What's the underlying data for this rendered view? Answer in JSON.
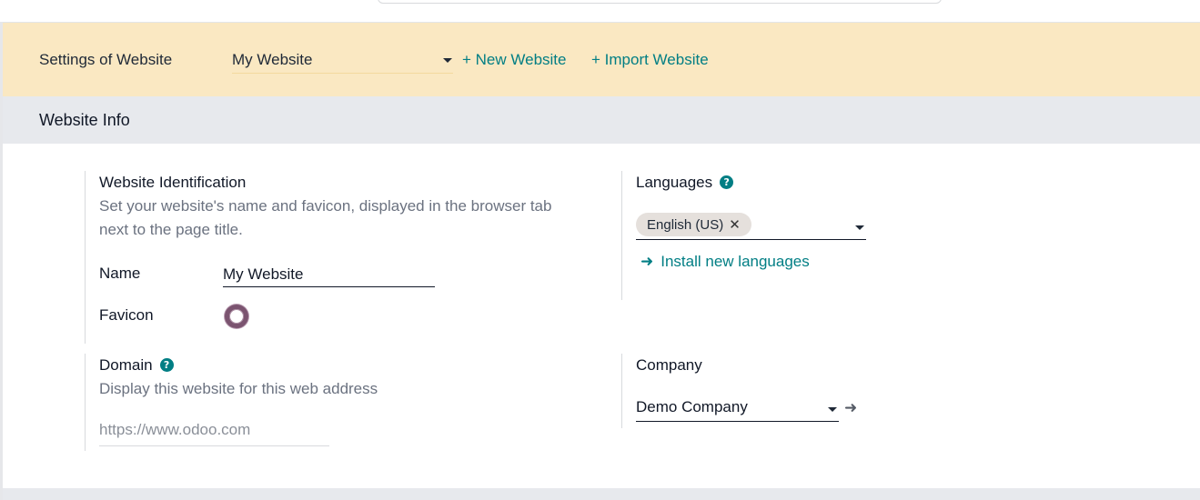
{
  "header": {
    "title": "Settings of Website",
    "selected_website": "My Website",
    "new_website_label": "+ New Website",
    "import_website_label": "+ Import Website"
  },
  "section": {
    "title": "Website Info"
  },
  "identification": {
    "title": "Website Identification",
    "description": "Set your website's name and favicon, displayed in the browser tab next to the page title.",
    "name_label": "Name",
    "name_value": "My Website",
    "favicon_label": "Favicon"
  },
  "languages": {
    "title": "Languages",
    "help_glyph": "?",
    "tags": [
      "English (US)"
    ],
    "tag_remove_glyph": "✕",
    "install_link_arrow": "➜",
    "install_link": "Install new languages"
  },
  "domain": {
    "title": "Domain",
    "help_glyph": "?",
    "description": "Display this website for this web address",
    "placeholder": "https://www.odoo.com"
  },
  "company": {
    "title": "Company",
    "value": "Demo Company",
    "open_arrow": "➜"
  },
  "colors": {
    "accent": "#017e84",
    "banner_bg": "#fae8c2",
    "section_bg": "#e7e9ed"
  }
}
